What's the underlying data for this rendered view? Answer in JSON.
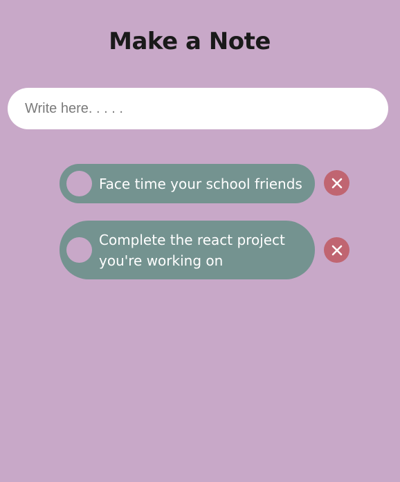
{
  "header": {
    "title": "Make a Note"
  },
  "input": {
    "placeholder": "Write here. . . . .",
    "value": ""
  },
  "notes": [
    {
      "text": "Face time your school friends",
      "done": false
    },
    {
      "text": "Complete the react project you're working on",
      "done": false
    }
  ],
  "icons": {
    "complete": "circle-check-icon",
    "delete": "close-icon"
  },
  "colors": {
    "background": "#c8a8c8",
    "note": "#749390",
    "delete": "#c06571",
    "input": "#ffffff",
    "title": "#1a1a1a"
  }
}
